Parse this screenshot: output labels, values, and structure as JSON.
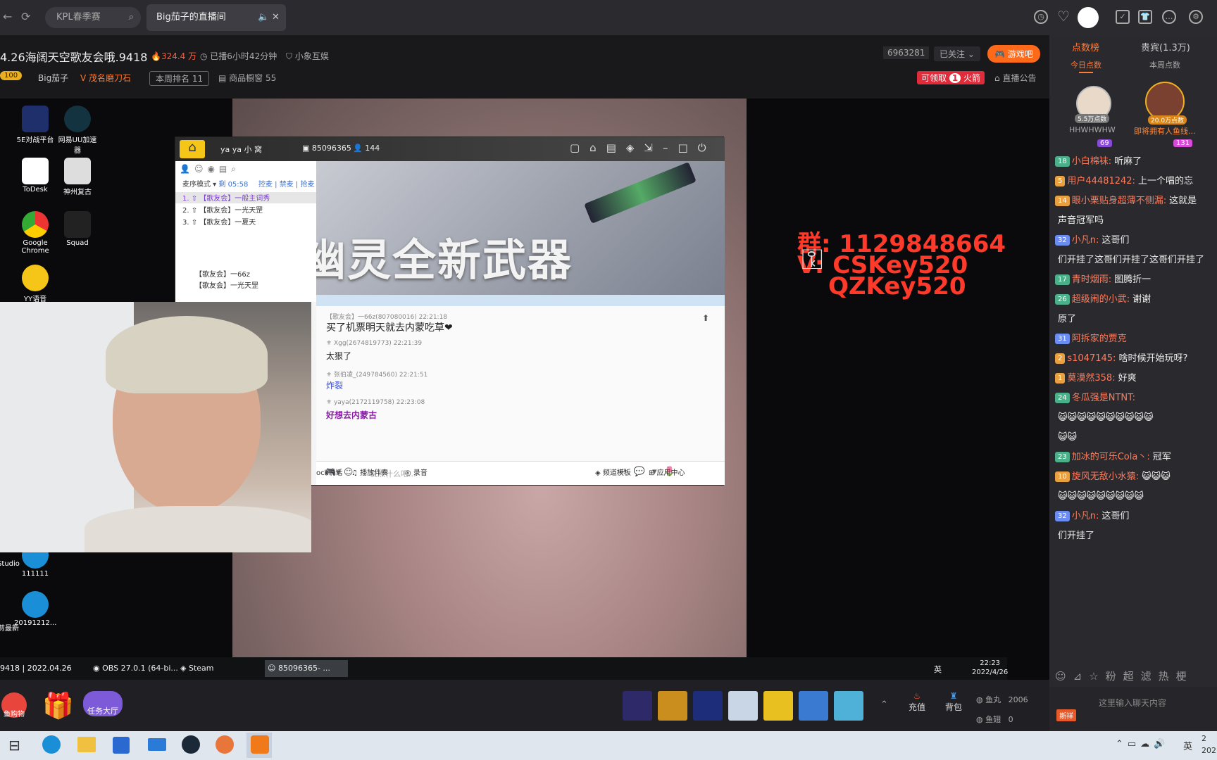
{
  "browser": {
    "search_placeholder": "KPL春季赛",
    "tab_title": "Big茄子的直播间",
    "tab_sound": "🔈",
    "tab_close": "✕"
  },
  "room": {
    "title": "4.26海阔天空歌友会哦.9418",
    "heat": "324.4 万",
    "live_time": "已播6小时42分钟",
    "category": "小象互娱",
    "fans": "6963281",
    "follow": "已关注",
    "game_btn": "游戏吧",
    "level": "100",
    "streamer": "Big茄子",
    "medal": "茂名磨刀石",
    "rank": "本周排名 11",
    "shop": "商品橱窗 55",
    "coupon": "可领取",
    "coupon_num": "1",
    "coupon_tail": "火箭",
    "notice": "直播公告"
  },
  "desktop": {
    "icons": [
      {
        "label": "5E对战平台"
      },
      {
        "label": "网易UU加速器"
      },
      {
        "label": "ToDesk"
      },
      {
        "label": "神州复古"
      },
      {
        "label": "Google Chrome"
      },
      {
        "label": "Squad"
      },
      {
        "label": "YY语音"
      },
      {
        "label": "111111"
      },
      {
        "label": "20191212..."
      },
      {
        "label": "Studio"
      },
      {
        "label": "剪最新"
      }
    ]
  },
  "overlay": {
    "line1": "群: 1129848664",
    "line2": "V: CSKey520",
    "line3": "QZKey520"
  },
  "yy": {
    "channel": "ya ya 小 窝",
    "id": "85096365",
    "users": "144",
    "mode": "麦序模式",
    "timer": "剩 05:58",
    "links": [
      "控麦",
      "禁麦",
      "抢麦"
    ],
    "queue": [
      {
        "n": "1.",
        "t": "【歌友会】一般主词秀"
      },
      {
        "n": "2.",
        "t": "【歌友会】一光天罡"
      },
      {
        "n": "3.",
        "t": "【歌友会】一夏天"
      }
    ],
    "members": [
      {
        "t": "【歌友会】一66z"
      },
      {
        "t": "【歌友会】一光天罡"
      }
    ],
    "banner_text": "幽灵全新武器",
    "msgs": [
      {
        "user": "【歌友会】一66z(807080016)",
        "time": "22:21:18",
        "text": "买了机票明天就去内蒙吃草❤"
      },
      {
        "user": "Xgg(2674819773)",
        "time": "22:21:39",
        "text": "太狠了"
      },
      {
        "user": "张伯凌_(249784560)",
        "time": "22:21:51",
        "text": "炸裂"
      },
      {
        "user": "yaya(2172119758)",
        "time": "22:23:08",
        "text": "好想去内蒙古"
      }
    ],
    "input_placeholder": "说点什么吧...",
    "bottom": [
      "ock说话",
      "播放伴奏",
      "录音",
      "频道模板",
      "应用中心"
    ]
  },
  "vtask": {
    "left": "9418 | 2022.04.26",
    "apps": [
      "OBS 27.0.1 (64-bi...",
      "Steam",
      "85096365- ..."
    ],
    "time": "22:23",
    "date": "2022/4/26",
    "lang": "英"
  },
  "bottombar": {
    "gift1": "鱼购物",
    "gift3": "任务大厅",
    "recharge": "充值",
    "bag": "背包",
    "fishball_label": "鱼丸",
    "fishball": "2006",
    "fishwing_label": "鱼翅",
    "fishwing": "0"
  },
  "panel": {
    "tab1": "点数榜",
    "tab2": "贵宾(1.3万)",
    "sub1": "今日点数",
    "sub2": "本周点数",
    "top": [
      {
        "pts": "5.5万点数",
        "name": "HHWHWHW",
        "lvl": "69"
      },
      {
        "pts": "20.0万点数",
        "name": "即将拥有人鱼线...",
        "lvl": "131"
      }
    ],
    "chat": [
      {
        "lv": "18",
        "name": "小白棉袜:",
        "text": "听麻了",
        "bg": "#4bb08a"
      },
      {
        "lv": "5",
        "name": "用户44481242:",
        "text": "上一个唱的忘",
        "bg": "#e8a040"
      },
      {
        "lv": "14",
        "name": "眼小栗贴身超薄不侧漏:",
        "text": "这就是",
        "bg": "#e8a040"
      },
      {
        "lv": "",
        "name": "",
        "text": "声音冠军吗",
        "bg": ""
      },
      {
        "lv": "32",
        "name": "小凡n:",
        "text": "这哥们",
        "bg": "#6b8cf0"
      },
      {
        "lv": "",
        "name": "",
        "text": "们开挂了这哥们开挂了这哥们开挂了",
        "bg": ""
      },
      {
        "lv": "17",
        "name": "青时烟雨:",
        "text": "图腾折一",
        "bg": "#4bb08a"
      },
      {
        "lv": "26",
        "name": "超级闹的小武:",
        "text": "谢谢",
        "bg": "#4bb08a"
      },
      {
        "lv": "",
        "name": "",
        "text": "原了",
        "bg": ""
      },
      {
        "lv": "31",
        "name": "阿拆家的贾克",
        "text": "",
        "bg": "#6b8cf0"
      },
      {
        "lv": "2",
        "name": "s1047145:",
        "text": "啥时候开始玩呀?",
        "bg": "#e8a040"
      },
      {
        "lv": "1",
        "name": "莫漠然358:",
        "text": "好爽",
        "bg": "#e8a040"
      },
      {
        "lv": "24",
        "name": "冬瓜强是NTNT:",
        "text": "",
        "bg": "#4bb08a"
      },
      {
        "lv": "",
        "name": "",
        "text": "😺😺😺😺😺😺😺😺😺😺",
        "bg": ""
      },
      {
        "lv": "",
        "name": "",
        "text": "😺😺",
        "bg": ""
      },
      {
        "lv": "23",
        "name": "加冰的可乐Cola丶:",
        "text": "冠军",
        "bg": "#4bb08a"
      },
      {
        "lv": "10",
        "name": "旋风无敌小水猿:",
        "text": "😺😺😺",
        "bg": "#e8a040"
      },
      {
        "lv": "",
        "name": "",
        "text": "😺😺😺😺😺😺😺😺😺",
        "bg": ""
      },
      {
        "lv": "32",
        "name": "小凡n:",
        "text": "这哥们",
        "bg": "#6b8cf0"
      },
      {
        "lv": "",
        "name": "",
        "text": "们开挂了",
        "bg": ""
      }
    ],
    "input_placeholder": "这里输入聊天内容",
    "bottom_badge": "斯祥"
  },
  "wtask": {
    "lang": "英",
    "time": "2",
    "date": "202"
  }
}
